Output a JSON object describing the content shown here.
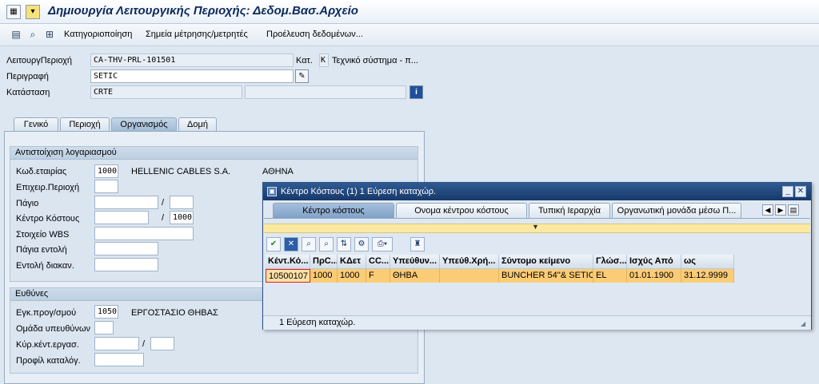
{
  "window": {
    "title": "Δημιουργία Λειτουργικής Περιοχής: Δεδομ.Βασ.Αρχείο"
  },
  "toolbar": {
    "items": [
      "Κατηγοριοποίηση",
      "Σημεία μέτρησης/μετρητές",
      "Προέλευση δεδομένων..."
    ]
  },
  "header": {
    "funcloc_label": "ΛειτουργΠεριοχή",
    "funcloc_value": "CA-THV-PRL-101501",
    "category_label": "Κατ.",
    "category_value": "K",
    "category_text": "Τεχνικό σύστημα - π...",
    "description_label": "Περιγραφή",
    "description_value": "SETIC",
    "status_label": "Κατάσταση",
    "status_value": "CRTE"
  },
  "tabs": [
    "Γενικό",
    "Περιοχή",
    "Οργανισμός",
    "Δομή"
  ],
  "account_group": {
    "title": "Αντιστοίχιση λογαριασμού",
    "company_code_label": "Κωδ.εταιρίας",
    "company_code_value": "1000",
    "company_name": "HELLENIC CABLES S.A.",
    "company_city": "ΑΘΗΝΑ",
    "business_area_label": "Επιχειρ.Περιοχή",
    "asset_label": "Πάγιο",
    "cost_center_label": "Κέντρο Κόστους",
    "cost_center_area": "1000",
    "wbs_label": "Στοιχείο WBS",
    "asset_order_label": "Πάγια εντολή",
    "settlement_order_label": "Εντολή διακαν.",
    "slash": "/"
  },
  "responsibility_group": {
    "title": "Ευθύνες",
    "planning_plant_label": "Εγκ.προγ/σμού",
    "planning_plant_value": "1050",
    "planning_plant_text": "ΕΡΓΟΣΤΑΣΙΟ ΘΗΒΑΣ",
    "planner_group_label": "Ομάδα υπευθύνων",
    "main_work_center_label": "Κύρ.κέντ.εργασ.",
    "catalog_profile_label": "Προφίλ καταλόγ.",
    "slash": "/"
  },
  "popup": {
    "title": "Κέντρο Κόστους (1)    1 Εύρεση καταχώρ.",
    "tabs": [
      "Κέντρο κόστους",
      "Ονομα κέντρου κόστους",
      "Τυπική Ιεραρχία",
      "Οργανωτική μονάδα μέσω Π..."
    ],
    "columns": [
      "Κέντ.Κό...",
      "ΠρC...",
      "ΚΔετ",
      "CC...",
      "Υπεύθυν...",
      "Υπεύθ.Χρή...",
      "Σύντομο κείμενο",
      "Γλώσ...",
      "Ισχύς Από",
      "ως"
    ],
    "rows": [
      [
        "10500107",
        "1000",
        "1000",
        "F",
        "ΘΗΒΑ",
        "",
        "BUNCHER 54''& SETIC",
        "EL",
        "01.01.1900",
        "31.12.9999"
      ]
    ],
    "status": "1 Εύρεση καταχώρ."
  }
}
